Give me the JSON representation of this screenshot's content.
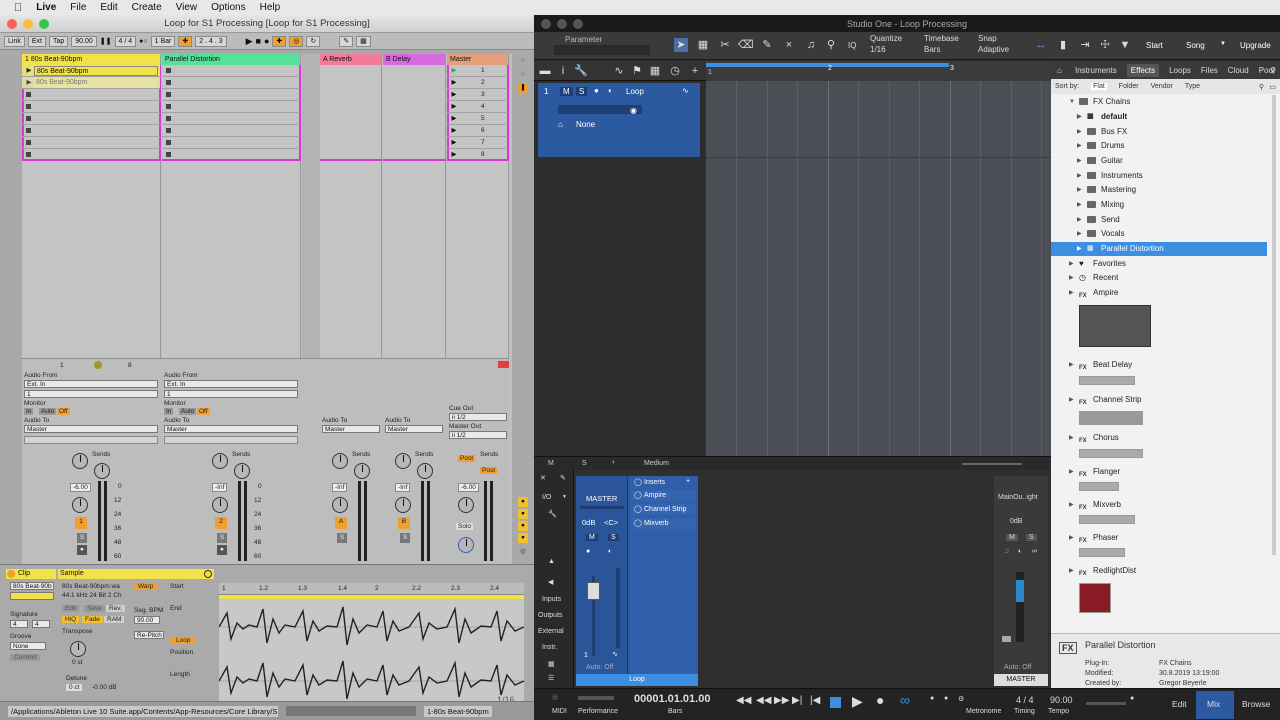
{
  "menubar": {
    "apple": "",
    "app": "Live",
    "items": [
      "File",
      "Edit",
      "Create",
      "View",
      "Options",
      "Help"
    ]
  },
  "live": {
    "window_title": "Loop for S1 Processing  [Loop for S1 Processing]",
    "control": {
      "link": "Link",
      "ext": "Ext",
      "tap": "Tap",
      "bpm": "90.00",
      "sig": "4 / 4",
      "quant": "1 Bar",
      "pos": "2 .  4 .  3"
    },
    "tracks": [
      {
        "name": "1 80s Beat-90bpm",
        "color": "#f2e24a",
        "number": "1",
        "clips": [
          "80s Beat-90bpm",
          "80s Beat-90bpm"
        ]
      },
      {
        "name": "Parallel Distortion",
        "color": "#57e09a",
        "number": "2",
        "clips": []
      },
      {
        "name": "A Reverb",
        "color": "#f27a9a",
        "number": "A",
        "clips": []
      },
      {
        "name": "B Delay",
        "color": "#d86ae0",
        "number": "B",
        "clips": []
      },
      {
        "name": "Master",
        "color": "#e3a07a",
        "number": "",
        "clips": []
      }
    ],
    "scene_numbers": [
      "1",
      "2",
      "3",
      "4",
      "5",
      "6",
      "7",
      "8"
    ],
    "io": {
      "audio_from": "Audio From",
      "ext_in": "Ext. In",
      "in_ch": "1",
      "monitor": "Monitor",
      "in": "In",
      "auto": "Auto",
      "off": "Off",
      "audio_to": "Audio To",
      "master": "Master",
      "cue_out": "Cue Out",
      "cue_val": "ii 1/2",
      "master_out": "Master Out",
      "master_val": "ii 1/2",
      "sends": "Sends",
      "post": "Post",
      "solo": "Solo",
      "row_1": "1",
      "row_8": "8"
    },
    "volumes": [
      "-6.00",
      "-Inf",
      "-Inf",
      "-Inf",
      "-6.00"
    ],
    "db_scale": [
      "0",
      "12",
      "24",
      "36",
      "48",
      "60"
    ],
    "clip_panel": {
      "clip": "Clip",
      "sample": "Sample",
      "clip_name": "80s Beat-90b",
      "file": "80s Beat-90bpm.wa",
      "format": "44.1 kHz 24 Bit 2 Ch",
      "warp": "Warp",
      "start": "Start",
      "end": "End",
      "signature": "Signature",
      "sig_num": "4",
      "sig_den": "4",
      "groove": "Groove",
      "groove_val": "None",
      "commit": "Commit",
      "seg_bpm": "Seg. BPM",
      "seg_val": "90.00",
      "loop": "Loop",
      "position": "Position",
      "length": "Length",
      "transpose": "Transpose",
      "transpose_val": "0 st",
      "detune": "Detune",
      "detune_val": "0 ct",
      "gain": "-0.00 dB",
      "hiq": "HiQ",
      "fade": "Fade",
      "ram": "RAM",
      "mode": "Re-Pitch",
      "edit": "Edit",
      "save": "Save",
      "rev": "Rev.",
      "ruler": [
        "1",
        "1.2",
        "1.3",
        "1.4",
        "2",
        "2.2",
        "2.3",
        "2.4"
      ],
      "page": "1/16"
    },
    "status": {
      "path": "/Applications/Ableton Live 10 Suite.app/Contents/App-Resources/Core Library/S",
      "track": "1-80s Beat-90bpm"
    }
  },
  "s1": {
    "window_title": "Studio One - Loop Processing",
    "top": {
      "parameter": "Parameter",
      "quantize": "Quantize",
      "quantize_val": "1/16",
      "timebase": "Timebase",
      "timebase_val": "Bars",
      "snap": "Snap",
      "snap_val": "Adaptive",
      "start": "Start",
      "song": "Song",
      "upgrade": "Upgrade",
      "iq": "IQ"
    },
    "ruler": [
      "1",
      "2",
      "3"
    ],
    "track": {
      "num": "1",
      "m": "M",
      "s": "S",
      "name": "Loop",
      "input": "None"
    },
    "arr_footer": {
      "m": "M",
      "s": "S",
      "size": "Medium"
    },
    "mixer": {
      "io": "I/O",
      "master": "MASTER",
      "db": "0dB",
      "pan": "<C>",
      "m": "M",
      "s": "S",
      "inserts": "Inserts",
      "plugins": [
        "Ampire",
        "Channel Strip",
        "Mixverb"
      ],
      "auto": "Auto: Off",
      "channel_name": "Loop",
      "ch_num": "1",
      "side": [
        "Inputs",
        "Outputs",
        "External",
        "Instr."
      ],
      "main_out": "MainOu..ight",
      "main_db": "0dB",
      "main_label": "MASTER"
    },
    "transport": {
      "midi": "MIDI",
      "performance": "Performance",
      "time": "00001.01.01.00",
      "unit": "Bars",
      "metronome": "Metronome",
      "timing": "Timing",
      "sig": "4 / 4",
      "tempo_label": "Tempo",
      "tempo": "90.00",
      "edit": "Edit",
      "mix": "Mix",
      "browse": "Browse"
    },
    "browser": {
      "tabs": [
        "Instruments",
        "Effects",
        "Loops",
        "Files",
        "Cloud",
        "Pool"
      ],
      "active_tab": "Effects",
      "sort_by": "Sort by:",
      "sorts": [
        "Flat",
        "Folder",
        "Vendor",
        "Type"
      ],
      "tree_root": "FX Chains",
      "folders": [
        "default",
        "Bus FX",
        "Drums",
        "Guitar",
        "Instruments",
        "Mastering",
        "Mixing",
        "Send",
        "Vocals"
      ],
      "selected": "Parallel Distortion",
      "sections": [
        "Favorites",
        "Recent"
      ],
      "plugins": [
        "Ampire",
        "Beat Delay",
        "Channel Strip",
        "Chorus",
        "Flanger",
        "Mixverb",
        "Phaser",
        "RedlightDist"
      ],
      "fx_tag": "FX",
      "info": {
        "name": "Parallel Distortion",
        "plugin_label": "Plug-In:",
        "plugin": "FX Chains",
        "modified_label": "Modified:",
        "modified": "30.8.2019 13:19:00",
        "created_label": "Created by:",
        "created": "Gregor Beyerle"
      }
    }
  },
  "colors": {
    "s1_blue": "#2c5aa0",
    "s1_select": "#3d8ee0",
    "live_yellow": "#f2e24a",
    "live_green": "#57e09a",
    "live_magenta": "#d838d8"
  }
}
